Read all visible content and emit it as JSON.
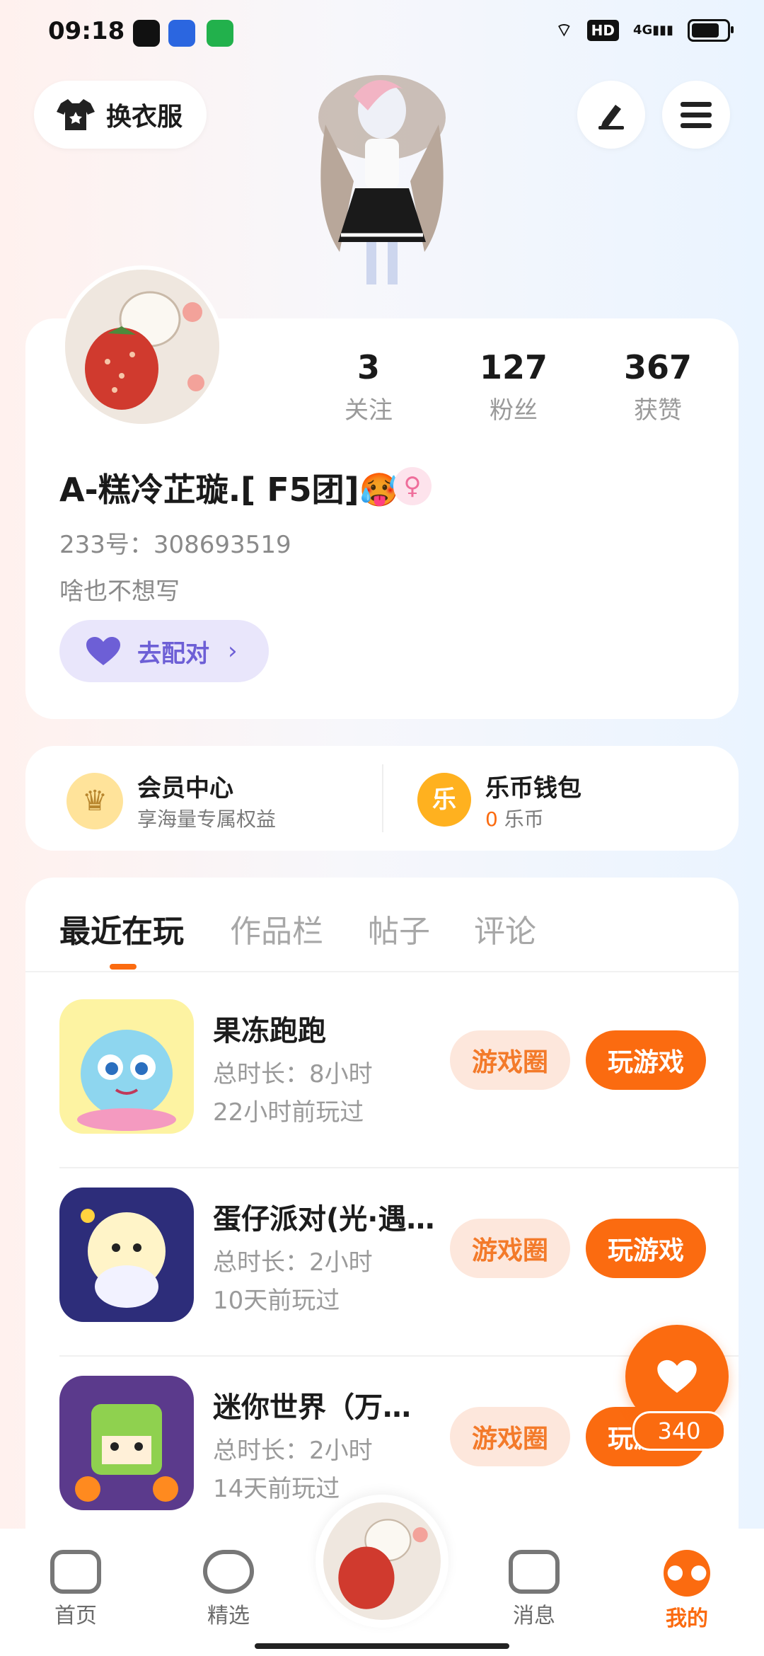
{
  "status_bar": {
    "time": "09:18",
    "network": "4G",
    "hd": "HD"
  },
  "top_bar": {
    "dress_up_label": "换衣服"
  },
  "profile": {
    "stats": [
      {
        "num": "3",
        "label": "关注"
      },
      {
        "num": "127",
        "label": "粉丝"
      },
      {
        "num": "367",
        "label": "获赞"
      }
    ],
    "name": "A-糕冷芷璇.[ F5团]🥵",
    "id_text": "233号：308693519",
    "bio": "啥也不想写",
    "match_button": "去配对"
  },
  "membership": {
    "vip_title": "会员中心",
    "vip_sub": "享海量专属权益",
    "wallet_title": "乐币钱包",
    "wallet_amount": "0",
    "wallet_unit": "乐币",
    "coin_glyph": "乐"
  },
  "tabs": [
    "最近在玩",
    "作品栏",
    "帖子",
    "评论"
  ],
  "games": [
    {
      "title": "果冻跑跑",
      "duration": "总时长：8小时",
      "last_played": "22小时前玩过",
      "circle_btn": "游戏圈",
      "play_btn": "玩游戏"
    },
    {
      "title": "蛋仔派对(光·遇…",
      "duration": "总时长：2小时",
      "last_played": "10天前玩过",
      "circle_btn": "游戏圈",
      "play_btn": "玩游戏"
    },
    {
      "title": "迷你世界（万…",
      "duration": "总时长：2小时",
      "last_played": "14天前玩过",
      "circle_btn": "游戏圈",
      "play_btn": "玩游戏"
    }
  ],
  "floating": {
    "likes": "340"
  },
  "bottom_nav": [
    {
      "label": "首页"
    },
    {
      "label": "精选"
    },
    {
      "label": "消息"
    },
    {
      "label": "我的"
    }
  ],
  "colors": {
    "accent": "#fb6b10",
    "match_bg": "#e9e6fb",
    "match_text": "#6d5fd6"
  }
}
